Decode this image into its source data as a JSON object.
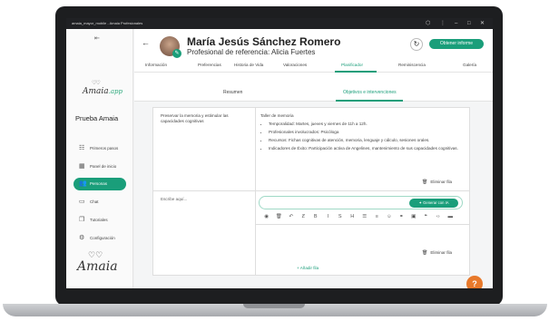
{
  "window": {
    "title": "amaia_mayor_mobile - Amaia Profesionales"
  },
  "brand": {
    "logo_text": "Amaia",
    "logo_suffix": ".app",
    "accent": "#1a9e7a",
    "fab_color": "#e8792b"
  },
  "sidebar": {
    "org_name": "Prueba Amaia",
    "items": [
      {
        "label": "Primeros pasos",
        "icon": "steps-icon"
      },
      {
        "label": "Panel de inicio",
        "icon": "dashboard-icon"
      },
      {
        "label": "Personas",
        "icon": "people-icon",
        "active": true
      },
      {
        "label": "Chat",
        "icon": "chat-icon"
      },
      {
        "label": "Tutoriales",
        "icon": "tutorial-icon"
      },
      {
        "label": "Configuración",
        "icon": "gear-icon"
      }
    ],
    "footer_logo": "Amaia"
  },
  "header": {
    "name": "María Jesús Sánchez Romero",
    "subtitle": "Profesional de referencia: Alicia Fuertes",
    "report_button": "Obtener informe"
  },
  "tabs": [
    "Información",
    "Preferencias",
    "Historia de Vida",
    "Valoraciones",
    "Planificador",
    "Reminiscencia",
    "Galería"
  ],
  "active_tab": "Planificador",
  "subtabs": [
    "Resumen",
    "Objetivos e intervenciones"
  ],
  "active_subtab": "Objetivos e intervenciones",
  "table": {
    "row1": {
      "objective": "Preservar la memoria y estimular las capacidades cognitivas",
      "title": "Taller de memoria",
      "bullets": [
        "Temporalidad: Martes, jueves y viernes de 11h a 12h.",
        "Profesionales involucrados: Psicóloga",
        "Recursos: Fichas cognitivas de atención, memoria, lenguaje y cálculo, sesiones orales.",
        "Indicadores de Éxito: Participación activa de Angelines, mantenimiento de sus capacidades cognitivas."
      ],
      "delete_label": "Eliminar fila"
    },
    "row2": {
      "placeholder": "Escribe aquí...",
      "generate_label": "Generar con IA",
      "delete_label": "Eliminar fila"
    },
    "add_row_label": "+ Añadir fila"
  },
  "toolbar_icons": [
    "eye-icon",
    "trash-icon",
    "undo-icon",
    "strike-icon",
    "bold-icon",
    "italic-icon",
    "strikethrough-icon",
    "heading-icon",
    "bullet-list-icon",
    "ordered-list-icon",
    "emoji-icon",
    "link-icon",
    "image-icon",
    "quote-icon",
    "code-icon",
    "hr-icon"
  ],
  "toolbar_glyphs": [
    "◉",
    "🗑",
    "↶",
    "Ƶ",
    "B",
    "I",
    "S",
    "H",
    "☰",
    "≡",
    "☺",
    "⚭",
    "▣",
    "❝",
    "‹›",
    "▬"
  ],
  "fab_label": "?"
}
